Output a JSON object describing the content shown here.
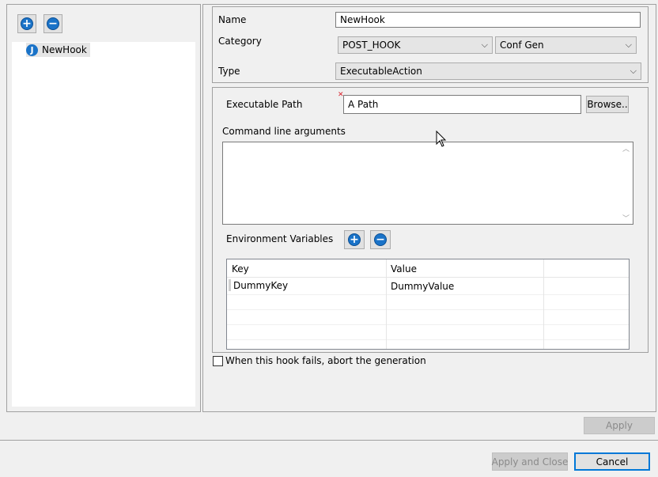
{
  "tree": {
    "items": [
      {
        "label": "NewHook"
      }
    ]
  },
  "form": {
    "name_label": "Name",
    "name_value": "NewHook",
    "category_label": "Category",
    "category_value": "POST_HOOK",
    "subcategory_value": "Conf Gen",
    "type_label": "Type",
    "type_value": "ExecutableAction",
    "exec_path_label": "Executable Path",
    "exec_path_value": "A Path",
    "browse_label": "Browse..",
    "cmd_args_label": "Command line arguments",
    "cmd_args_value": "",
    "env_vars_label": "Environment Variables",
    "env_table": {
      "columns": [
        "Key",
        "Value"
      ],
      "rows": [
        {
          "key": "DummyKey",
          "value": "DummyValue"
        }
      ]
    },
    "abort_label": "When this hook fails, abort the generation",
    "abort_checked": false
  },
  "buttons": {
    "apply": "Apply",
    "apply_and_close": "Apply and Close",
    "cancel": "Cancel"
  },
  "colors": {
    "accent": "#1a73c8",
    "focus": "#0078d7",
    "error": "#d9232d"
  }
}
